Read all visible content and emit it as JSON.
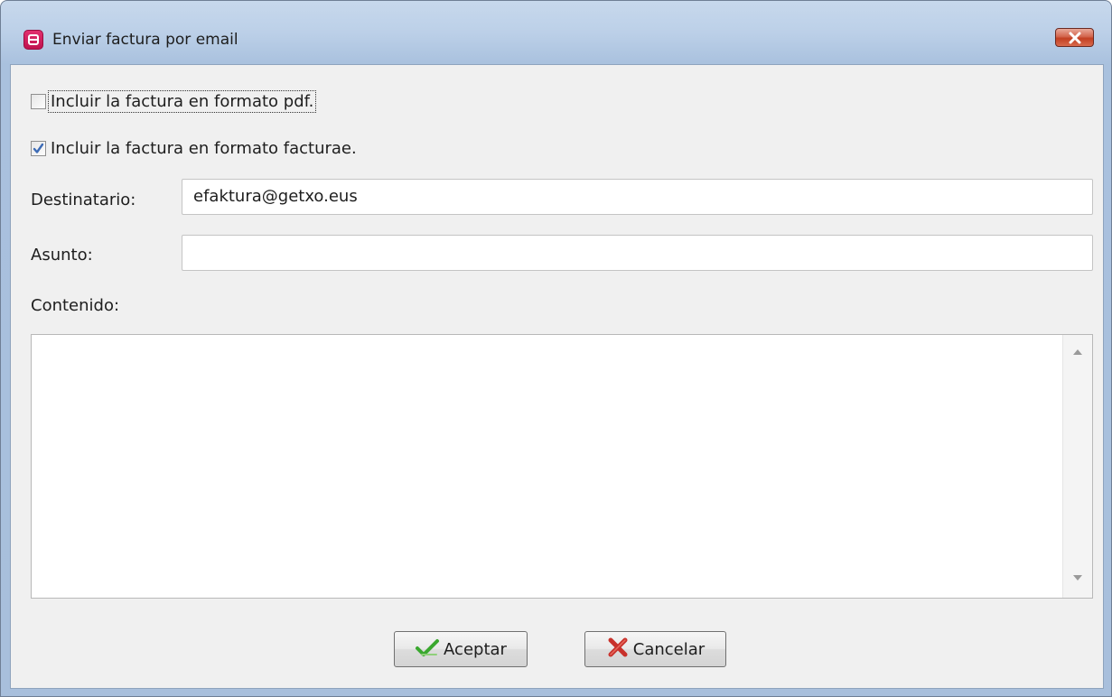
{
  "window": {
    "title": "Enviar factura por email",
    "icon": "app-logo-icon",
    "close_icon": "close-icon"
  },
  "options": {
    "include_pdf": {
      "label": "Incluir la factura en formato pdf.",
      "checked": false
    },
    "include_facturae": {
      "label": "Incluir la factura en formato facturae.",
      "checked": true
    }
  },
  "form": {
    "recipient_label": "Destinatario:",
    "recipient_value": "efaktura@getxo.eus",
    "subject_label": "Asunto:",
    "subject_value": "",
    "content_label": "Contenido:",
    "content_value": ""
  },
  "buttons": {
    "accept_label": "Aceptar",
    "cancel_label": "Cancelar"
  },
  "colors": {
    "accent_pink": "#d01f5f",
    "close_red": "#c74a31",
    "check_blue": "#3d6bb5"
  }
}
